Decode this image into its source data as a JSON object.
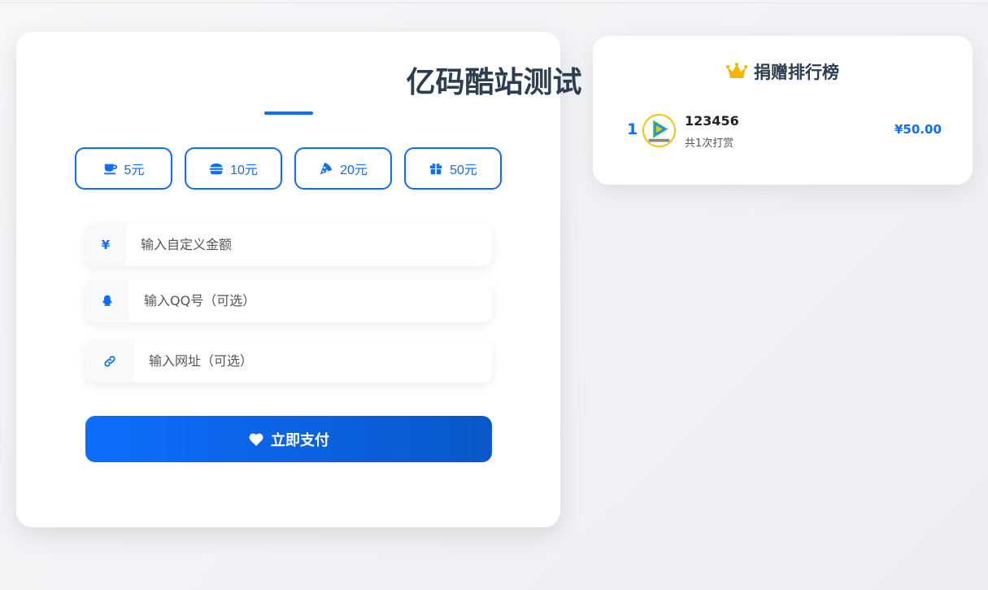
{
  "title": "亿码酷站测试",
  "amounts": [
    {
      "label": "5元",
      "icon": "coffee-icon"
    },
    {
      "label": "10元",
      "icon": "burger-icon"
    },
    {
      "label": "20元",
      "icon": "pizza-icon"
    },
    {
      "label": "50元",
      "icon": "gift-icon"
    }
  ],
  "fields": {
    "amount": {
      "symbol": "¥",
      "placeholder": "输入自定义金额"
    },
    "qq": {
      "placeholder": "输入QQ号（可选）",
      "icon": "qq-icon"
    },
    "url": {
      "placeholder": "输入网址（可选）",
      "icon": "link-icon"
    }
  },
  "pay_button": {
    "label": "立即支付",
    "icon": "heart-icon"
  },
  "ranking": {
    "title": "捐赠排行榜",
    "icon": "crown-icon",
    "items": [
      {
        "rank": "1",
        "name": "123456",
        "count": "共1次打赏",
        "amount": "¥50.00"
      }
    ]
  },
  "colors": {
    "accent": "#0d6efd",
    "title": "#2c3e50",
    "crown": "#f7b500"
  }
}
